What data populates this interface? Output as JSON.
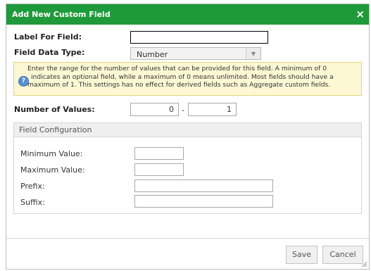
{
  "dialog": {
    "title": "Add New Custom Field",
    "close_glyph": "×"
  },
  "form": {
    "label_for_field": {
      "label": "Label For Field:",
      "value": ""
    },
    "field_data_type": {
      "label": "Field Data Type:",
      "selected": "Number"
    },
    "help": {
      "icon": "question-icon",
      "line1": "Enter the range for the number of values that can be provided for this field. A minimum of 0",
      "line2": "indicates an optional field, while a maximum of 0 means unlimited. Most fields should have a",
      "line3": "maximum of 1. This settings has no effect for derived fields such as Aggregate custom fields."
    },
    "number_of_values": {
      "label": "Number of Values:",
      "min": "0",
      "separator": "-",
      "max": "1"
    }
  },
  "field_configuration": {
    "title": "Field Configuration",
    "minimum_value": {
      "label": "Minimum Value:",
      "value": ""
    },
    "maximum_value": {
      "label": "Maximum Value:",
      "value": ""
    },
    "prefix": {
      "label": "Prefix:",
      "value": ""
    },
    "suffix": {
      "label": "Suffix:",
      "value": ""
    }
  },
  "footer": {
    "save_label": "Save",
    "cancel_label": "Cancel"
  },
  "colors": {
    "titlebar": "#1f9a3b",
    "help_background": "#fcf8d4",
    "help_icon": "#5a8fd0"
  }
}
